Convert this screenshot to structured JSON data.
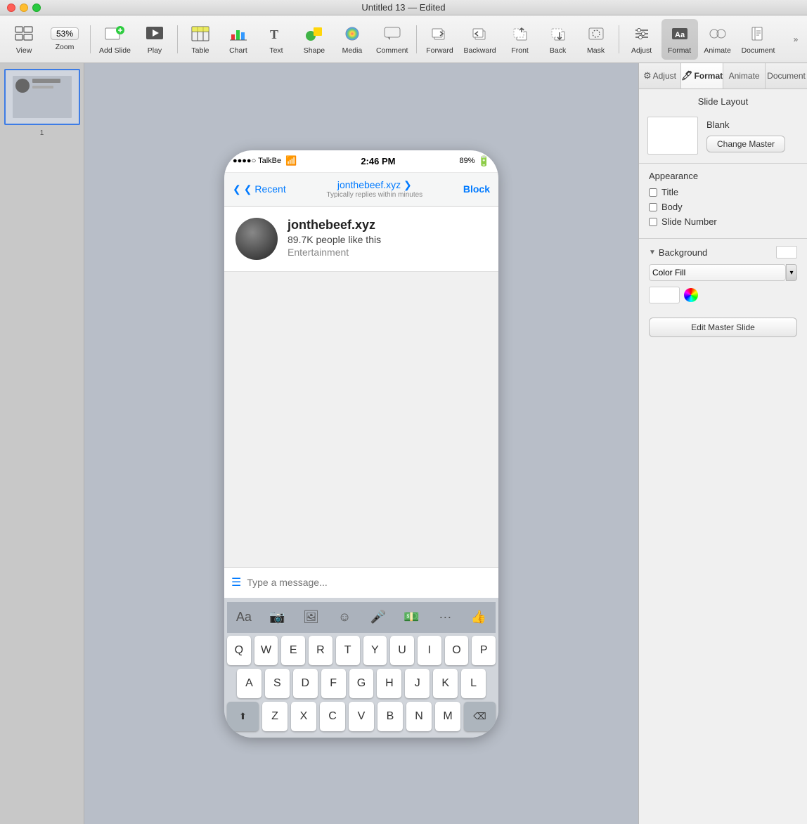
{
  "titlebar": {
    "title": "Untitled 13 — Edited"
  },
  "toolbar": {
    "view_label": "View",
    "zoom_label": "Zoom",
    "zoom_value": "53%",
    "add_slide_label": "Add Slide",
    "play_label": "Play",
    "table_label": "Table",
    "chart_label": "Chart",
    "text_label": "Text",
    "shape_label": "Shape",
    "media_label": "Media",
    "comment_label": "Comment",
    "forward_label": "Forward",
    "backward_label": "Backward",
    "front_label": "Front",
    "back_label": "Back",
    "mask_label": "Mask",
    "adjust_label": "Adjust",
    "format_label": "Format",
    "animate_label": "Animate",
    "document_label": "Document"
  },
  "slides_panel": {
    "slide_number": "1"
  },
  "right_panel": {
    "tabs": [
      "Adjust",
      "Format",
      "Animate",
      "Document"
    ],
    "active_tab": "Format",
    "section_title": "Slide Layout",
    "blank_label": "Blank",
    "change_master_label": "Change Master",
    "appearance_title": "Appearance",
    "checkbox_title": {
      "label": "Title"
    },
    "checkbox_body": {
      "label": "Body"
    },
    "checkbox_slide_number": {
      "label": "Slide Number"
    },
    "background_title": "Background",
    "color_fill_label": "Color Fill",
    "edit_master_label": "Edit Master Slide"
  },
  "phone": {
    "carrier": "●●●●○ TalkBe",
    "wifi_icon": "wifi",
    "time": "2:46 PM",
    "battery": "89%",
    "nav_back": "❮ Recent",
    "nav_title": "jonthebeef.xyz ❯",
    "nav_subtitle": "Typically replies within minutes",
    "nav_action": "Block",
    "page_name": "jonthebeef.xyz",
    "page_likes": "89.7K people like this",
    "page_category": "Entertainment",
    "message_placeholder": "Type a message...",
    "keyboard_rows": [
      [
        "Q",
        "W",
        "E",
        "R",
        "T",
        "Y",
        "U",
        "I",
        "O",
        "P"
      ],
      [
        "A",
        "S",
        "D",
        "F",
        "G",
        "H",
        "J",
        "K",
        "L"
      ],
      [
        "Z",
        "X",
        "C",
        "V",
        "B",
        "N",
        "M"
      ]
    ]
  }
}
